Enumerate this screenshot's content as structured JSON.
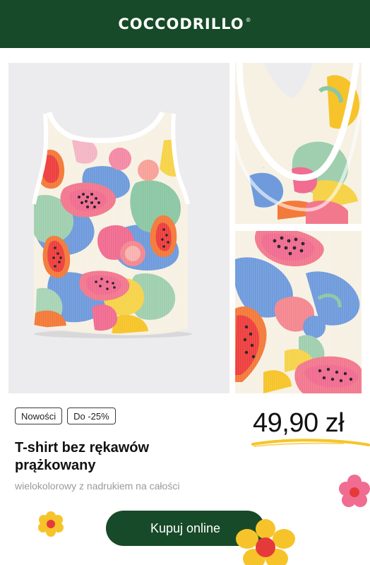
{
  "header": {
    "brand": "COCCODRILLO",
    "registered": "®",
    "background": "#174a28"
  },
  "product": {
    "badges": [
      "Nowości",
      "Do -25%"
    ],
    "price": "49,90 zł",
    "title": "T-shirt bez rękawów prążkowany",
    "subtitle": "wielokolorowy z nadrukiem na całości"
  },
  "cta": {
    "label": "Kupuj online",
    "background": "#174a28"
  },
  "colors": {
    "accent_yellow": "#f6c42a",
    "flower_pink": "#f06c91",
    "flower_center": "#e63a3a"
  },
  "icons": [
    "flower-icon",
    "price-underline-icon"
  ]
}
